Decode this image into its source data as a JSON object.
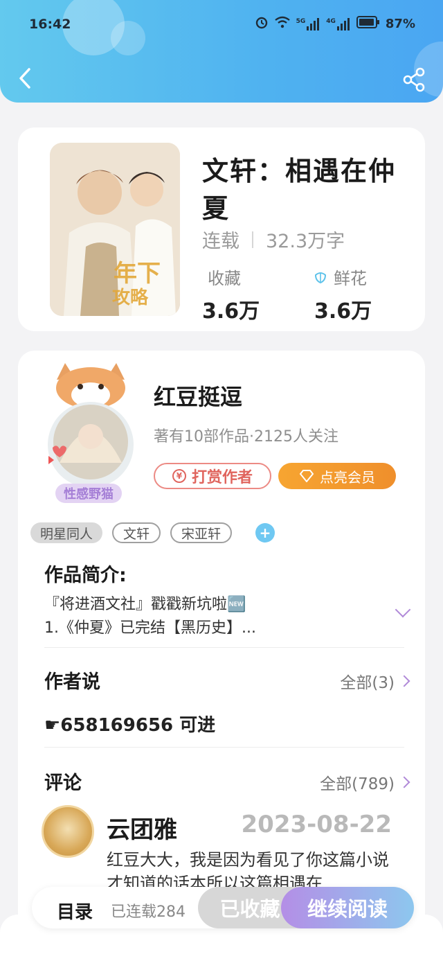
{
  "status_bar": {
    "time": "16:42",
    "battery": "87%",
    "net1": "5G",
    "net2": "4G"
  },
  "header": {
    "back_icon": "chevron-left-icon",
    "share_icon": "share-icon"
  },
  "book": {
    "title": "文轩：相遇在仲夏",
    "status": "连载",
    "word_count": "32.3万字",
    "favorites_label": "收藏",
    "favorites_value": "3.6万",
    "flowers_label": "鲜花",
    "flowers_value": "3.6万"
  },
  "author": {
    "name": "红豆挺逗",
    "meta": "著有10部作品·2125人关注",
    "avatar_badge": "性感野猫",
    "tip_label": "打赏作者",
    "vip_label": "点亮会员"
  },
  "tags": [
    "明星同人",
    "文轩",
    "宋亚轩"
  ],
  "intro": {
    "title": "作品简介:",
    "lines": [
      "『将进酒文社』戳戳新坑啦🆕",
      "1.《仲夏》已完结【黑历史】..."
    ]
  },
  "author_says": {
    "title": "作者说",
    "more": "全部(3)",
    "text": "☛658169656 可进"
  },
  "comments": {
    "title": "评论",
    "more": "全部(789)",
    "items": [
      {
        "user": "云团雅",
        "date": "2023-08-22",
        "text": "红豆大大，我是因为看见了你这篇小说才知道的话本所以这篇相遇在"
      }
    ]
  },
  "bottom_bar": {
    "toc_label": "目录",
    "toc_count": "已连载284",
    "fav_label": "已收藏",
    "read_label": "继续阅读"
  },
  "colors": {
    "header": "#4fb2f0",
    "vip": "#f09a2f",
    "tip": "#e0655e",
    "accent_purple": "#b089d8"
  }
}
